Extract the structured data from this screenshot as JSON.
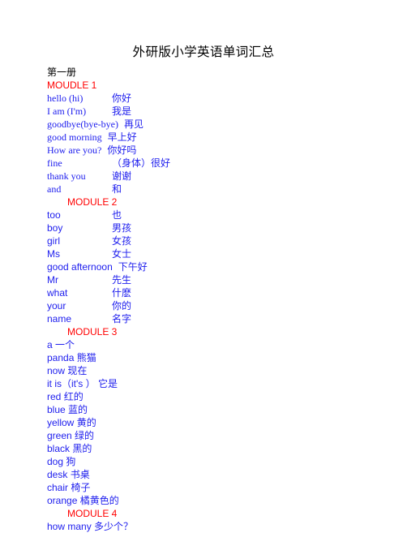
{
  "document": {
    "title": "外研版小学英语单词汇总",
    "volume_label": "第一册"
  },
  "colors": {
    "title_text": "#000000",
    "module_heading": "#ff0000",
    "entry_text": "#2020ee",
    "page_background": "#ffffff"
  },
  "modules": [
    {
      "heading": "MOUDLE 1",
      "indented": false,
      "font": "serif",
      "layout": "tabbed",
      "entries": [
        {
          "term": "hello (hi)",
          "gloss": "你好",
          "wide": false
        },
        {
          "term": "I am (I'm)",
          "gloss": "我是",
          "wide": false
        },
        {
          "term": "goodbye(bye-bye)",
          "gloss": "再见",
          "wide": true
        },
        {
          "term": "good morning",
          "gloss": "早上好",
          "wide": true
        },
        {
          "term": "How are you?",
          "gloss": "你好吗",
          "wide": true
        },
        {
          "term": "fine",
          "gloss": "（身体）很好",
          "wide": false
        },
        {
          "term": "thank you",
          "gloss": "谢谢",
          "wide": false
        },
        {
          "term": "and",
          "gloss": "和",
          "wide": false
        }
      ]
    },
    {
      "heading": "MODULE 2",
      "indented": true,
      "font": "sans",
      "layout": "tabbed",
      "entries": [
        {
          "term": "too",
          "gloss": "也",
          "wide": false
        },
        {
          "term": "boy",
          "gloss": "男孩",
          "wide": false
        },
        {
          "term": "girl",
          "gloss": "女孩",
          "wide": false
        },
        {
          "term": "Ms",
          "gloss": "女士",
          "wide": false
        },
        {
          "term": "good afternoon",
          "gloss": "下午好",
          "wide": true
        },
        {
          "term": "Mr",
          "gloss": "先生",
          "wide": false
        },
        {
          "term": "what",
          "gloss": "什麽",
          "wide": false
        },
        {
          "term": "your",
          "gloss": "你的",
          "wide": false
        },
        {
          "term": "name",
          "gloss": "名字",
          "wide": false
        }
      ]
    },
    {
      "heading": "MODULE 3",
      "indented": true,
      "font": "sans",
      "layout": "inline",
      "entries": [
        {
          "term": "a",
          "gloss": "一个",
          "wide": false
        },
        {
          "term": "panda",
          "gloss": "熊猫",
          "wide": false
        },
        {
          "term": "now",
          "gloss": "现在",
          "wide": false
        },
        {
          "term": "it is（it's ）",
          "gloss": "它是",
          "wide": false
        },
        {
          "term": "red",
          "gloss": "红的",
          "wide": false
        },
        {
          "term": "blue",
          "gloss": "蓝的",
          "wide": false
        },
        {
          "term": "yellow",
          "gloss": "黄的",
          "wide": false
        },
        {
          "term": "green",
          "gloss": "绿的",
          "wide": false
        },
        {
          "term": "black",
          "gloss": "黑的",
          "wide": false
        },
        {
          "term": "dog",
          "gloss": "狗",
          "wide": false
        },
        {
          "term": "desk",
          "gloss": "书桌",
          "wide": false
        },
        {
          "term": "chair",
          "gloss": "椅子",
          "wide": false
        },
        {
          "term": "orange",
          "gloss": "橘黄色的",
          "wide": false
        }
      ]
    },
    {
      "heading": "MODULE 4",
      "indented": true,
      "font": "sans",
      "layout": "inline",
      "entries": [
        {
          "term": "how many",
          "gloss": "多少个？",
          "wide": false
        }
      ]
    }
  ]
}
